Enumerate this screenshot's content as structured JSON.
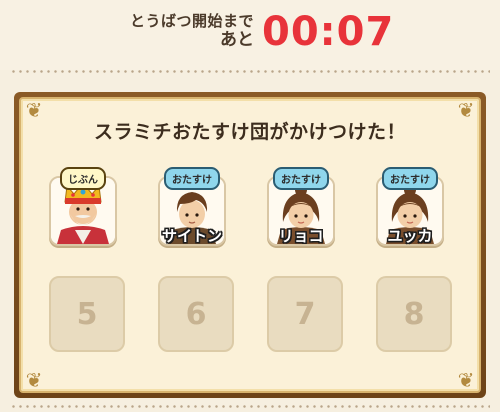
{
  "header": {
    "label_line1": "とうばつ開始まで",
    "label_line2": "あと",
    "timer": "00:07",
    "timer_color": "#e8333a"
  },
  "panel": {
    "title": "スラミチおたすけ団がかけつけた！",
    "members": [
      {
        "badge": "じぶん",
        "name": "",
        "avatar": "king-avatar-icon"
      },
      {
        "badge": "おたすけ",
        "name": "サイトン",
        "avatar": "male-hero-avatar-icon"
      },
      {
        "badge": "おたすけ",
        "name": "リョコ",
        "avatar": "female-hero-avatar-icon"
      },
      {
        "badge": "おたすけ",
        "name": "ユッカ",
        "avatar": "female-hero-avatar-icon"
      }
    ],
    "empty_slots": [
      "5",
      "6",
      "7",
      "8"
    ]
  }
}
